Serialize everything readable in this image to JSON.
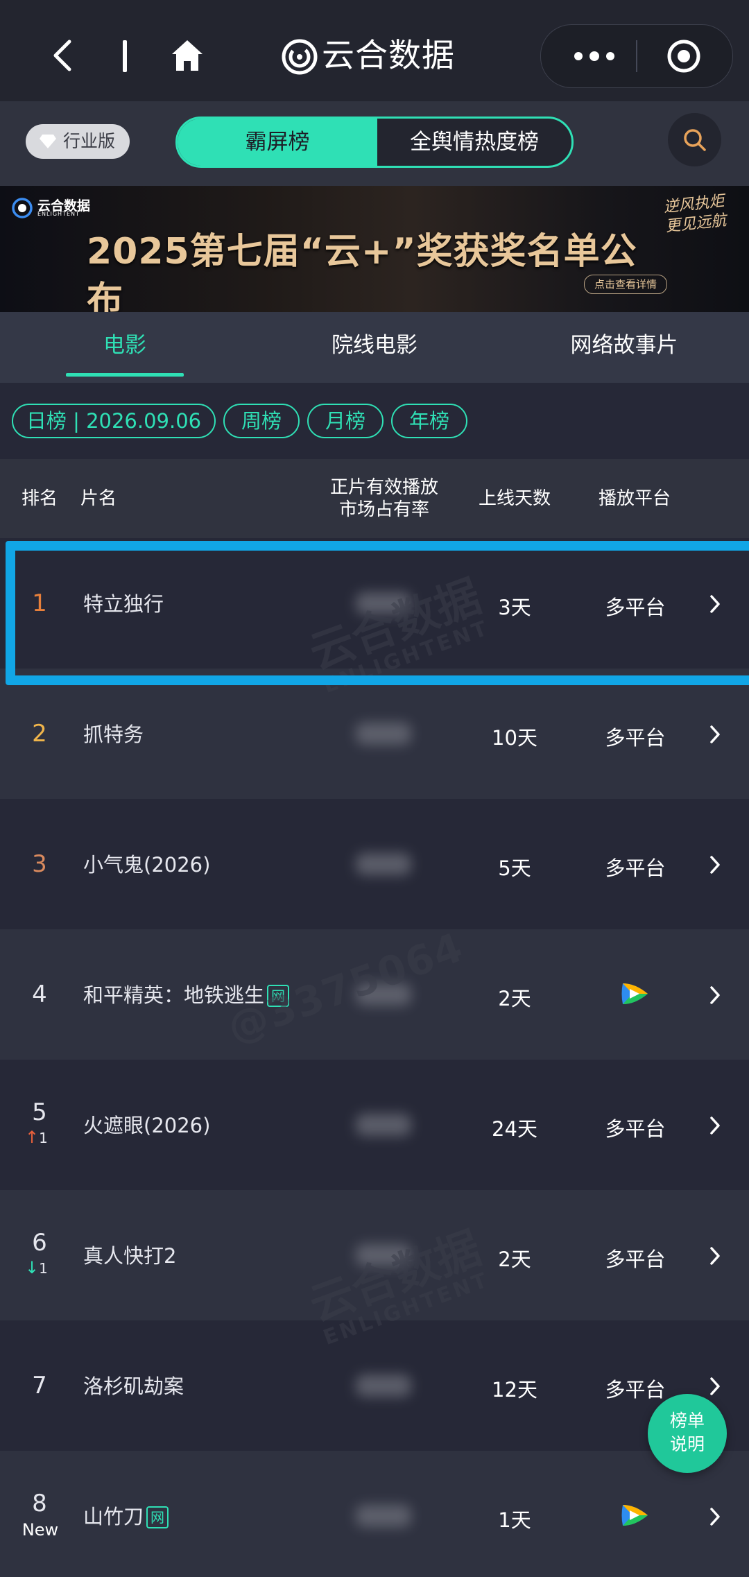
{
  "topbar": {
    "title": "云合数据",
    "icons": [
      "chevron-left-icon",
      "home-icon",
      "app-logo-icon",
      "more-icon",
      "capsule-close-icon"
    ]
  },
  "subheader": {
    "industry_label": "行业版",
    "segment_active": "霸屏榜",
    "segment_inactive": "全舆情热度榜"
  },
  "banner": {
    "logo_text": "云合数据",
    "logo_sub": "ENLIGHTENT",
    "title": "2025第七届“云+”奖获奖名单公布",
    "slogan": "逆风执炬 更见远航",
    "detail": "点击查看详情"
  },
  "category_tabs": [
    "电影",
    "院线电影",
    "网络故事片"
  ],
  "active_category": "电影",
  "periods": [
    "日榜 | 2026.09.06",
    "周榜",
    "月榜",
    "年榜"
  ],
  "columns": {
    "rank": "排名",
    "title": "片名",
    "share_line1": "正片有效播放",
    "share_line2": "市场占有率",
    "days": "上线天数",
    "platform": "播放平台"
  },
  "rows": [
    {
      "rank": "1",
      "title": "特立独行",
      "net": "",
      "days": "3天",
      "platform": "多平台"
    },
    {
      "rank": "2",
      "title": "抓特务",
      "net": "",
      "days": "10天",
      "platform": "多平台"
    },
    {
      "rank": "3",
      "title": "小气鬼(2026)",
      "net": "",
      "days": "5天",
      "platform": "多平台"
    },
    {
      "rank": "4",
      "title": "和平精英：地铁逃生",
      "net": "网",
      "days": "2天",
      "platform_icon": "tencent-video-icon"
    },
    {
      "rank": "5",
      "title": "火遮眼(2026)",
      "net": "",
      "days": "24天",
      "platform": "多平台",
      "trend": "up",
      "trend_value": "1"
    },
    {
      "rank": "6",
      "title": "真人快打2",
      "net": "",
      "days": "2天",
      "platform": "多平台",
      "trend": "down",
      "trend_value": "1"
    },
    {
      "rank": "7",
      "title": "洛杉矶劫案",
      "net": "",
      "days": "12天",
      "platform": "多平台"
    },
    {
      "rank": "8",
      "title": "山竹刀",
      "net": "网",
      "days": "1天",
      "platform_icon": "tencent-video-icon",
      "badge": "New"
    }
  ],
  "fab": {
    "line1": "榜单",
    "line2": "说明"
  },
  "watermark": {
    "brand": "云合数据",
    "brand_en": "ENLIGHTENT",
    "user": "@3375064"
  },
  "colors": {
    "accent": "#2fe0b5",
    "highlight": "#11a6e6",
    "rank1": "#e8803b",
    "rank2": "#f0b54b",
    "rank3": "#d98a5e",
    "trend_up": "#e8603b"
  }
}
